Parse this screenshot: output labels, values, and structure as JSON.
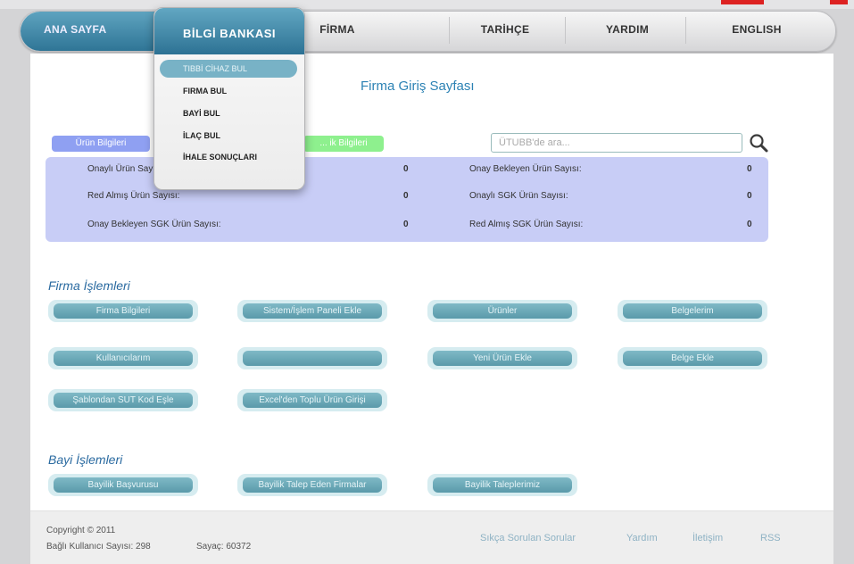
{
  "nav": {
    "items": [
      "ANA SAYFA",
      "FİRMA",
      "TARİHÇE",
      "YARDIM",
      "ENGLISH"
    ]
  },
  "dropdown": {
    "title": "BİLGİ BANKASI",
    "items": [
      "TIBBİ CİHAZ BUL",
      "FIRMA BUL",
      "BAYİ BUL",
      "İLAÇ BUL",
      "İHALE SONUÇLARI"
    ]
  },
  "page_title": "Firma Giriş Sayfası",
  "tabs": [
    "Ürün Bilgileri",
    "... ik Bilgileri"
  ],
  "search": {
    "placeholder": "ÜTUBB'de ara..."
  },
  "stats": [
    {
      "label": "Onaylı Ürün Sayısı:",
      "value": "0"
    },
    {
      "label": "Onay Bekleyen Ürün Sayısı:",
      "value": "0"
    },
    {
      "label": "Red Almış Ürün Sayısı:",
      "value": "0"
    },
    {
      "label": "Onaylı SGK Ürün Sayısı:",
      "value": "0"
    },
    {
      "label": "Onay Bekleyen SGK Ürün Sayısı:",
      "value": "0"
    },
    {
      "label": "Red Almış SGK Ürün Sayısı:",
      "value": "0"
    }
  ],
  "firma_section": {
    "title": "Firma İşlemleri",
    "buttons": [
      "Firma Bilgileri",
      "Sistem/İşlem Paneli Ekle",
      "Ürünler",
      "Belgelerim",
      "Kullanıcılarım",
      "",
      "Yeni Ürün Ekle",
      "Belge Ekle",
      "Şablondan SUT Kod Eşle",
      "Excel'den Toplu Ürün Girişi"
    ]
  },
  "bayi_section": {
    "title": "Bayi İşlemleri",
    "buttons": [
      "Bayilik Başvurusu",
      "Bayilik Talep Eden Firmalar",
      "Bayilik Taleplerimiz"
    ]
  },
  "footer": {
    "copyright": "Copyright © 2011",
    "users": "Bağlı Kullanıcı Sayısı: 298",
    "counter": "Sayaç: 60372",
    "links": [
      "Sıkça Sorulan Sorular",
      "Yardım",
      "İletişim",
      "RSS"
    ]
  },
  "colors": {
    "accent": "#2f7596",
    "stats_bg": "#c8cdf6",
    "button": "#6aa7b6"
  }
}
